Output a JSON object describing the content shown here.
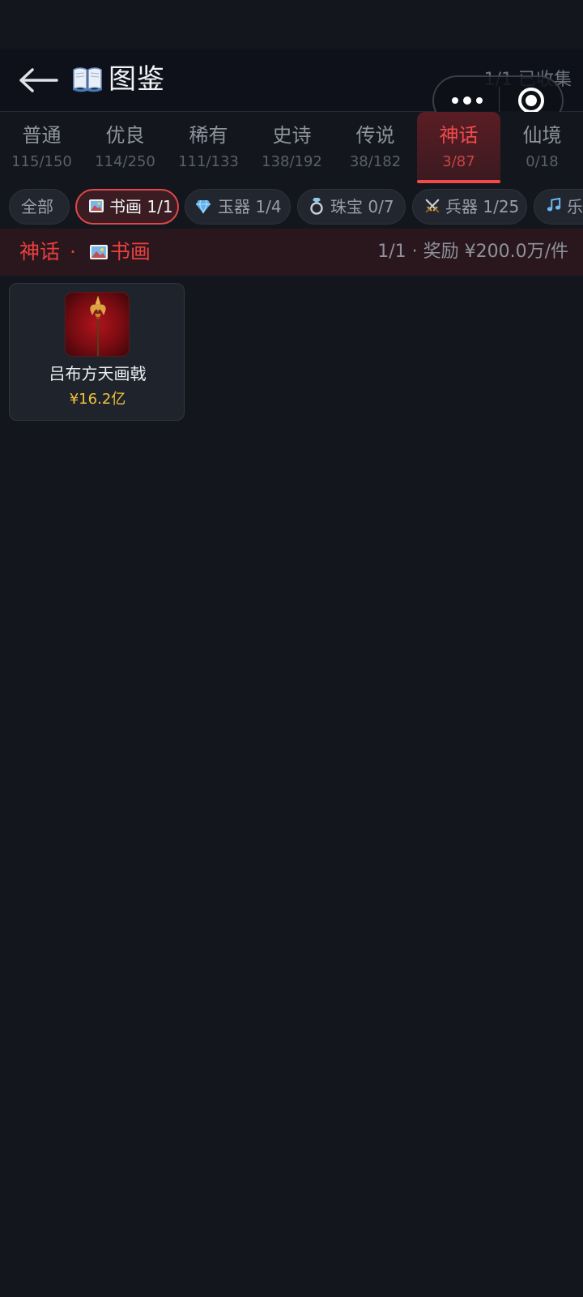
{
  "header": {
    "title": "图鉴",
    "collected_label": "1/1 已收集",
    "back_icon": "back-arrow-icon",
    "title_icon": "book-icon"
  },
  "capsule": {
    "more_icon": "more-dots-icon",
    "close_icon": "close-target-icon"
  },
  "rarity_tabs": [
    {
      "name": "普通",
      "count": "115/150",
      "active": false
    },
    {
      "name": "优良",
      "count": "114/250",
      "active": false
    },
    {
      "name": "稀有",
      "count": "111/133",
      "active": false
    },
    {
      "name": "史诗",
      "count": "138/192",
      "active": false
    },
    {
      "name": "传说",
      "count": "38/182",
      "active": false
    },
    {
      "name": "神话",
      "count": "3/87",
      "active": true
    },
    {
      "name": "仙境",
      "count": "0/18",
      "active": false
    }
  ],
  "category_chips": [
    {
      "label": "全部",
      "icon": "",
      "active": false
    },
    {
      "label": "书画 1/1",
      "icon": "painting-icon",
      "active": true
    },
    {
      "label": "玉器 1/4",
      "icon": "gem-icon",
      "active": false
    },
    {
      "label": "珠宝 0/7",
      "icon": "ring-icon",
      "active": false
    },
    {
      "label": "兵器 1/25",
      "icon": "crossed-swords-icon",
      "active": false
    },
    {
      "label": "乐",
      "icon": "music-note-icon",
      "active": false
    }
  ],
  "section": {
    "rarity": "神话",
    "separator": "·",
    "category": "书画",
    "category_icon": "painting-icon",
    "progress_reward": "1/1 · 奖励 ¥200.0万/件"
  },
  "items": [
    {
      "name": "吕布方天画戟",
      "price": "¥16.2亿",
      "icon": "halberd-icon"
    }
  ],
  "colors": {
    "accent_red": "#e8403f",
    "price_gold": "#f2c23c",
    "background": "#13161d"
  }
}
